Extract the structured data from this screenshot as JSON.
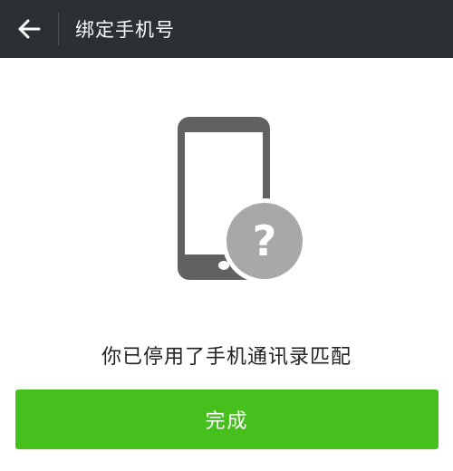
{
  "header": {
    "title": "绑定手机号",
    "back_icon": "arrow-left-icon",
    "background_color": "#2c3035"
  },
  "illustration": {
    "phone_icon": "mobile-phone-icon",
    "badge_icon": "question-mark-icon",
    "badge_text": "?",
    "phone_color": "#616161",
    "badge_color": "#a8a8a8"
  },
  "message": {
    "text": "你已停用了手机通讯录匹配"
  },
  "actions": {
    "done_label": "完成",
    "done_color": "#46c01c"
  }
}
